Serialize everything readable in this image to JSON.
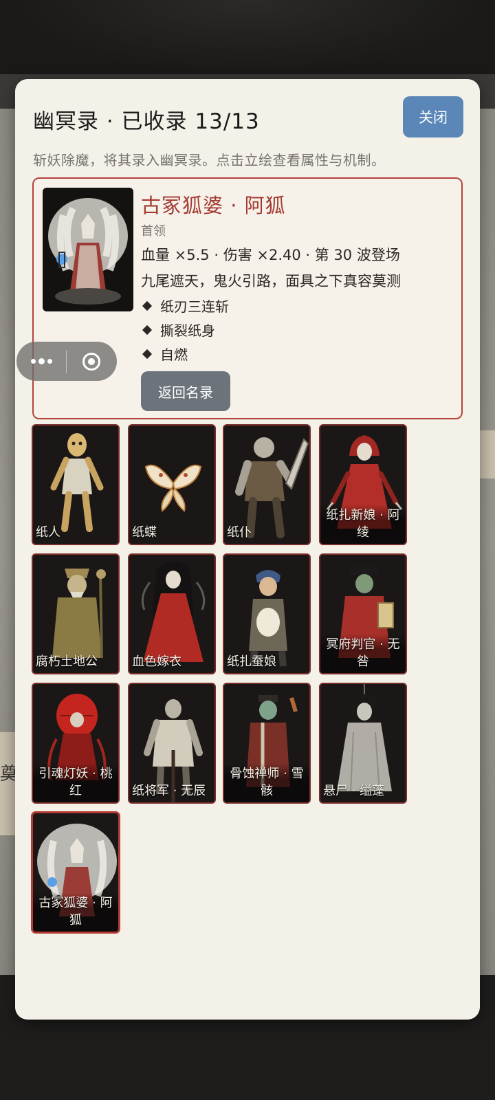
{
  "modal": {
    "title": "幽冥录 · 已收录 13/13",
    "close_label": "关闭",
    "description": "斩妖除魔，将其录入幽冥录。点击立绘查看属性与机制。"
  },
  "detail": {
    "name": "古冢狐婆 · 阿狐",
    "rank": "首领",
    "stats": "血量 ×5.5 · 伤害 ×2.40 · 第 30 波登场",
    "lore": "九尾遮天，鬼火引路，面具之下真容莫测",
    "skills": [
      "纸刃三连斩",
      "撕裂纸身",
      "自燃"
    ],
    "back_label": "返回名录"
  },
  "roster": [
    {
      "label": "纸人"
    },
    {
      "label": "纸蝶"
    },
    {
      "label": "纸仆"
    },
    {
      "label": "纸扎新娘 · 阿绫"
    },
    {
      "label": "腐朽土地公"
    },
    {
      "label": "血色嫁衣"
    },
    {
      "label": "纸扎蚕娘"
    },
    {
      "label": "冥府判官 · 无咎"
    },
    {
      "label": "引魂灯妖 · 桃红"
    },
    {
      "label": "纸将军 · 无辰"
    },
    {
      "label": "骨蚀禅师 · 雪骸"
    },
    {
      "label": "悬尸 · 缢蓬"
    },
    {
      "label": "古冢狐婆 · 阿狐"
    }
  ],
  "background": {
    "banner_char": "奠"
  },
  "colors": {
    "accent_blue": "#5b87b8",
    "boss_red": "#a33a32",
    "card_border": "#7a2e2a",
    "modal_bg": "#f4f1e8"
  }
}
